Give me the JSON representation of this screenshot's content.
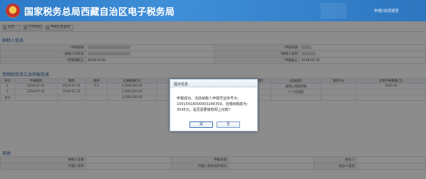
{
  "header": {
    "title": "国家税务总局西藏自治区电子税务局",
    "right_link": "申报/法规速查"
  },
  "toolbar": {
    "buttons": [
      "返回",
      "打印预览",
      "申报信息查询"
    ]
  },
  "sections": {
    "taxpayer_info": "纳税人信息",
    "summary": "货物和劳务汇总申报信息",
    "other": "其他"
  },
  "taxpayer_form": {
    "labels": [
      "申报期限",
      "纳税人识别号",
      "申报日期",
      "所属期起止",
      "纳税人名称",
      "申报截止"
    ],
    "values": [
      "",
      "",
      "",
      "2018-07-01",
      "",
      "2018-07-31"
    ]
  },
  "summary_table": {
    "headers": [
      "序号",
      "申报税款",
      "税款",
      "税率",
      "应纳税额(元)",
      "计税依据",
      "税款所属期",
      "征收项目",
      "征收品目",
      "税率(%)",
      "实际申报数额(元)"
    ],
    "rows": [
      [
        "1",
        "2018-07-01",
        "2018-07-31",
        "0.5",
        "1,000,000.00",
        "",
        "",
        "",
        "城镇土地使用税",
        "",
        "3545.00"
      ],
      [
        "2",
        "2018-07-01",
        "2018-07-31",
        "",
        "1,000,000.00",
        "",
        "",
        "",
        "个人所得税",
        "",
        ""
      ]
    ],
    "total_label": "合计",
    "total_value": "2,000,000.00"
  },
  "dialog": {
    "title": "提示信息",
    "message": "申报成功，当前纳税人申报凭证序号为：10015418000000246359，应缴纳税款为：3545元。是否需要缴款网上扣款？",
    "confirm_label": "是",
    "cancel_label": "否"
  },
  "footer_form": {
    "labels": [
      "纳税人签章",
      "申报日期",
      "经办人",
      "代理人名称",
      "代理人身份证件号码",
      "经办人电话"
    ],
    "values": [
      "",
      "",
      "",
      "",
      "",
      ""
    ]
  }
}
